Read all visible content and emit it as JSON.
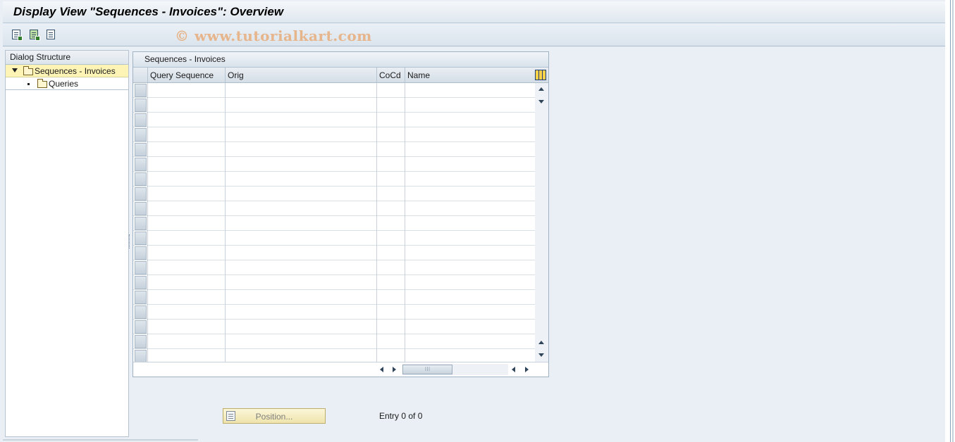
{
  "window": {
    "title": "Display View \"Sequences - Invoices\": Overview",
    "watermark": "© www.tutorialkart.com"
  },
  "toolbar": {
    "buttons": [
      {
        "icon": "select-all-icon"
      },
      {
        "icon": "select-block-icon"
      },
      {
        "icon": "deselect-all-icon"
      }
    ]
  },
  "dialog_structure": {
    "header": "Dialog Structure",
    "items": [
      {
        "label": "Sequences - Invoices",
        "icon": "folder-open-icon",
        "selected": true,
        "expanded": true
      },
      {
        "label": "Queries",
        "icon": "folder-icon",
        "selected": false
      }
    ]
  },
  "table": {
    "title": "Sequences - Invoices",
    "columns": [
      "Query Sequence",
      "Orig",
      "CoCd",
      "Name"
    ],
    "rows": [],
    "visible_empty_rows": 19
  },
  "footer": {
    "position_button": "Position...",
    "entry_text": "Entry 0 of 0"
  },
  "colors": {
    "background": "#e9eff5",
    "selected_node": "#fdf4b6",
    "position_button": "#f3eab9"
  }
}
